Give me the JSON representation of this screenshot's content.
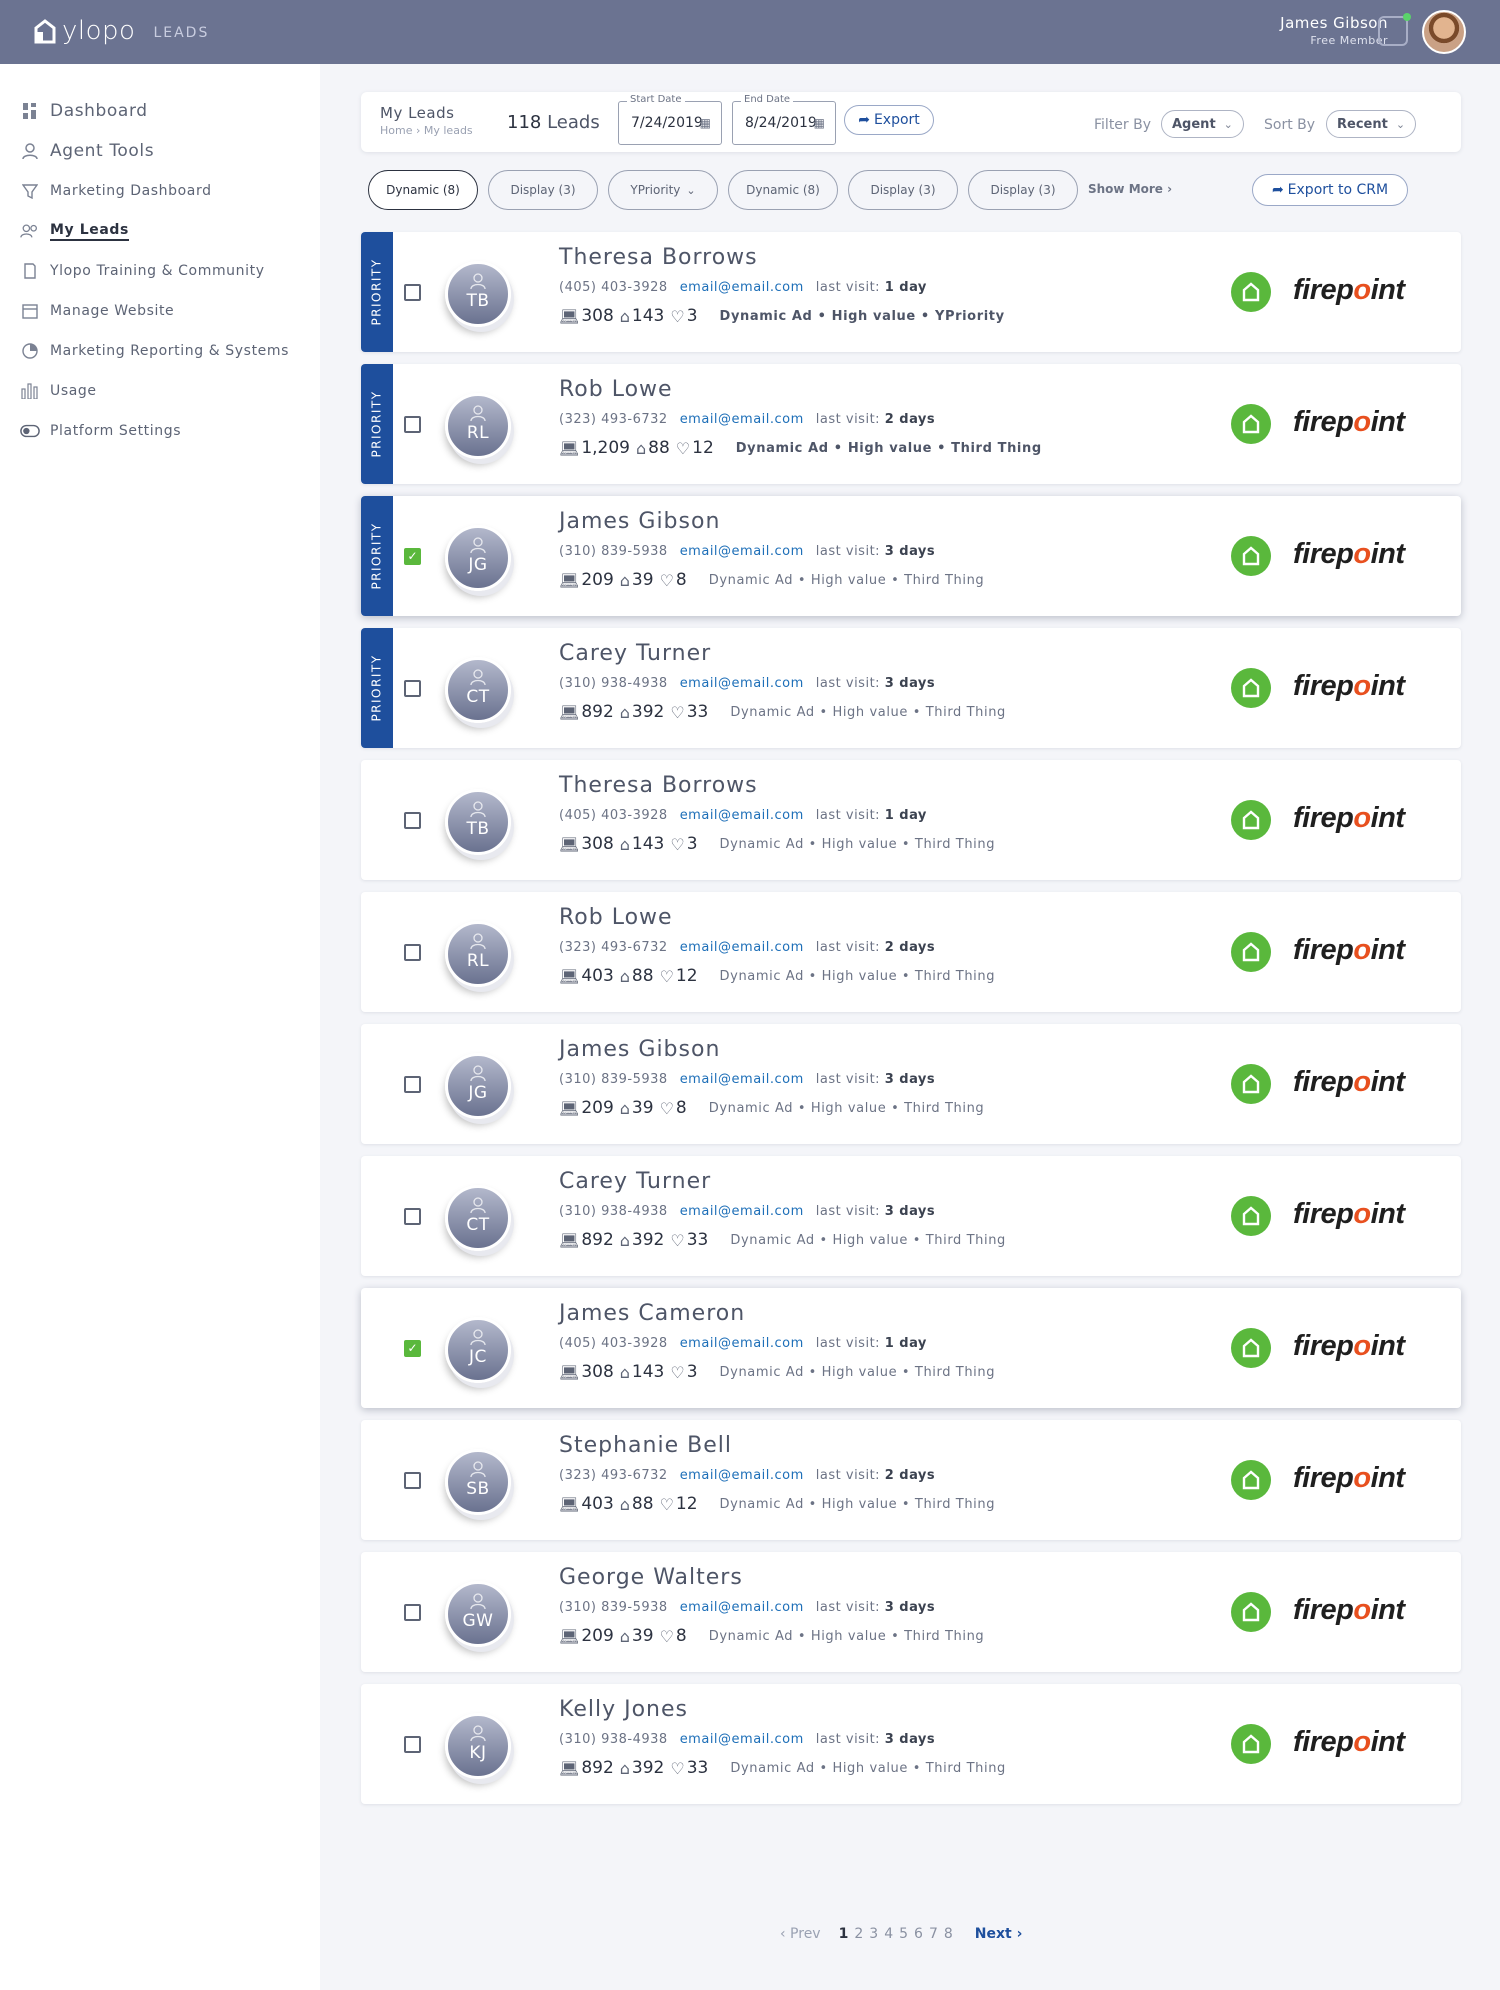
{
  "app": {
    "brand": "ylopo",
    "section": "LEADS"
  },
  "user": {
    "name": "James Gibson",
    "role": "Free Member"
  },
  "sidebar": {
    "items": [
      {
        "label": "Dashboard",
        "icon": "grid-icon"
      },
      {
        "label": "Agent Tools",
        "icon": "person-icon"
      },
      {
        "label": "Marketing Dashboard",
        "icon": "filter-icon"
      },
      {
        "label": "My Leads",
        "icon": "people-icon"
      },
      {
        "label": "Ylopo Training & Community",
        "icon": "book-icon"
      },
      {
        "label": "Manage Website",
        "icon": "calendar-icon"
      },
      {
        "label": "Marketing Reporting & Systems",
        "icon": "pie-icon"
      },
      {
        "label": "Usage",
        "icon": "bars-icon"
      },
      {
        "label": "Platform Settings",
        "icon": "toggle-icon"
      }
    ]
  },
  "header": {
    "title": "My Leads",
    "breadcrumb": "Home › My leads",
    "count_number": "118",
    "count_label": "Leads",
    "start_label": "Start Date",
    "start_value": "7/24/2019",
    "end_label": "End Date",
    "end_value": "8/24/2019",
    "export_label": "Export",
    "filter_label": "Filter By",
    "filter_value": "Agent",
    "sort_label": "Sort By",
    "sort_value": "Recent"
  },
  "chips": [
    {
      "label": "Dynamic (8)",
      "active": true
    },
    {
      "label": "Display (3)"
    },
    {
      "label": "YPriority",
      "dropdown": true
    },
    {
      "label": "Dynamic (8)"
    },
    {
      "label": "Display (3)"
    },
    {
      "label": "Display (3)"
    }
  ],
  "show_more": "Show More ›",
  "export_crm": "Export to CRM",
  "priority_label": "PRIORITY",
  "brand_logo": "firepoint",
  "leads": [
    {
      "name": "Theresa Borrows",
      "initials": "TB",
      "phone": "(405) 403-3928",
      "email": "email@email.com",
      "visit_label": "last visit:",
      "visit": "1 day",
      "views": "308",
      "homes": "143",
      "likes": "3",
      "tags": "Dynamic Ad • High value • YPriority",
      "priority": true,
      "checked": false
    },
    {
      "name": "Rob Lowe",
      "initials": "RL",
      "phone": "(323) 493-6732",
      "email": "email@email.com",
      "visit_label": "last visit:",
      "visit": "2 days",
      "views": "1,209",
      "homes": "88",
      "likes": "12",
      "tags": "Dynamic Ad • High value • Third Thing",
      "priority": true,
      "checked": false
    },
    {
      "name": "James Gibson",
      "initials": "JG",
      "phone": "(310) 839-5938",
      "email": "email@email.com",
      "visit_label": "last visit:",
      "visit": "3 days",
      "views": "209",
      "homes": "39",
      "likes": "8",
      "tags": "Dynamic Ad • High value • Third Thing",
      "priority": true,
      "checked": true
    },
    {
      "name": "Carey Turner",
      "initials": "CT",
      "phone": "(310) 938-4938",
      "email": "email@email.com",
      "visit_label": "last visit:",
      "visit": "3 days",
      "views": "892",
      "homes": "392",
      "likes": "33",
      "tags": "Dynamic Ad • High value • Third Thing",
      "priority": true,
      "checked": false
    },
    {
      "name": "Theresa Borrows",
      "initials": "TB",
      "phone": "(405) 403-3928",
      "email": "email@email.com",
      "visit_label": "last visit:",
      "visit": "1 day",
      "views": "308",
      "homes": "143",
      "likes": "3",
      "tags": "Dynamic Ad • High value • Third Thing",
      "priority": false,
      "checked": false
    },
    {
      "name": "Rob Lowe",
      "initials": "RL",
      "phone": "(323) 493-6732",
      "email": "email@email.com",
      "visit_label": "last visit:",
      "visit": "2 days",
      "views": "403",
      "homes": "88",
      "likes": "12",
      "tags": "Dynamic Ad • High value • Third Thing",
      "priority": false,
      "checked": false
    },
    {
      "name": "James Gibson",
      "initials": "JG",
      "phone": "(310) 839-5938",
      "email": "email@email.com",
      "visit_label": "last visit:",
      "visit": "3 days",
      "views": "209",
      "homes": "39",
      "likes": "8",
      "tags": "Dynamic Ad • High value • Third Thing",
      "priority": false,
      "checked": false
    },
    {
      "name": "Carey Turner",
      "initials": "CT",
      "phone": "(310) 938-4938",
      "email": "email@email.com",
      "visit_label": "last visit:",
      "visit": "3 days",
      "views": "892",
      "homes": "392",
      "likes": "33",
      "tags": "Dynamic Ad • High value • Third Thing",
      "priority": false,
      "checked": false
    },
    {
      "name": "James Cameron",
      "initials": "JC",
      "phone": "(405) 403-3928",
      "email": "email@email.com",
      "visit_label": "last visit:",
      "visit": "1 day",
      "views": "308",
      "homes": "143",
      "likes": "3",
      "tags": "Dynamic Ad • High value • Third Thing",
      "priority": false,
      "checked": true
    },
    {
      "name": "Stephanie Bell",
      "initials": "SB",
      "phone": "(323) 493-6732",
      "email": "email@email.com",
      "visit_label": "last visit:",
      "visit": "2 days",
      "views": "403",
      "homes": "88",
      "likes": "12",
      "tags": "Dynamic Ad • High value • Third Thing",
      "priority": false,
      "checked": false
    },
    {
      "name": "George Walters",
      "initials": "GW",
      "phone": "(310) 839-5938",
      "email": "email@email.com",
      "visit_label": "last visit:",
      "visit": "3 days",
      "views": "209",
      "homes": "39",
      "likes": "8",
      "tags": "Dynamic Ad • High value • Third Thing",
      "priority": false,
      "checked": false
    },
    {
      "name": "Kelly Jones",
      "initials": "KJ",
      "phone": "(310) 938-4938",
      "email": "email@email.com",
      "visit_label": "last visit:",
      "visit": "3 days",
      "views": "892",
      "homes": "392",
      "likes": "33",
      "tags": "Dynamic Ad • High value • Third Thing",
      "priority": false,
      "checked": false
    }
  ],
  "pagination": {
    "prev": "‹ Prev",
    "pages": [
      "1",
      "2",
      "3",
      "4",
      "5",
      "6",
      "7",
      "8"
    ],
    "current": "1",
    "next": "Next ›"
  },
  "colors": {
    "topbar": "#6b7391",
    "priority": "#1e4f9d",
    "accent_green": "#5ab83c",
    "link": "#1e6fb8"
  }
}
